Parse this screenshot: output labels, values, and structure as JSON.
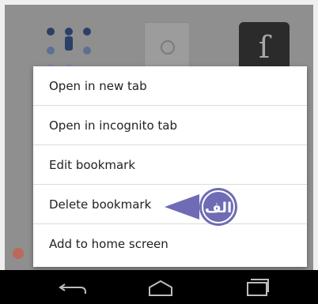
{
  "menu": {
    "items": [
      {
        "label": "Open in new tab"
      },
      {
        "label": "Open in incognito tab"
      },
      {
        "label": "Edit bookmark"
      },
      {
        "label": "Delete bookmark"
      },
      {
        "label": "Add to home screen"
      }
    ]
  },
  "annotation": {
    "badge_text": "الف",
    "color": "#6f6bb5"
  },
  "navigation": {
    "buttons": [
      "back-icon",
      "home-icon",
      "recents-icon"
    ]
  }
}
